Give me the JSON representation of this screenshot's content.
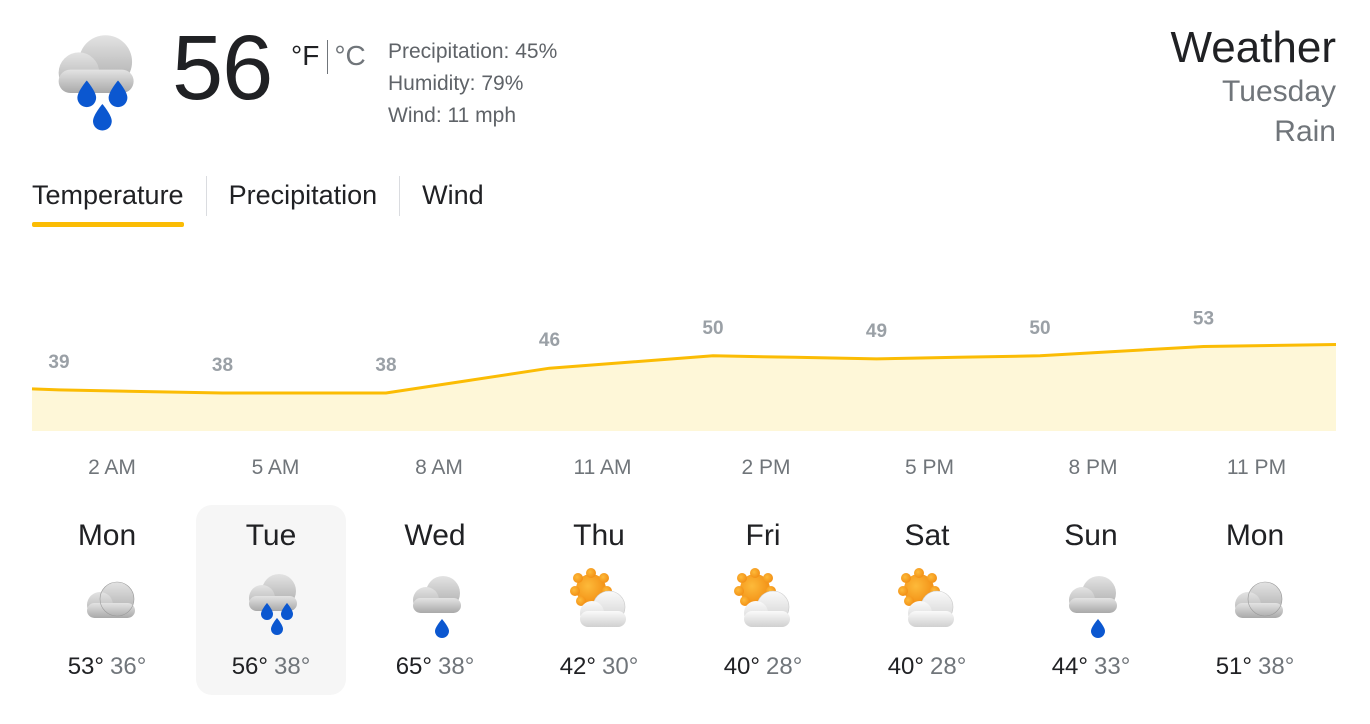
{
  "current": {
    "icon": "rain-icon",
    "temperature": "56",
    "unit_f": "°F",
    "unit_c": "°C",
    "precipitation": "Precipitation: 45%",
    "humidity": "Humidity: 79%",
    "wind": "Wind: 11 mph"
  },
  "header": {
    "title": "Weather",
    "day": "Tuesday",
    "condition": "Rain"
  },
  "tabs": [
    {
      "label": "Temperature",
      "active": true
    },
    {
      "label": "Precipitation",
      "active": false
    },
    {
      "label": "Wind",
      "active": false
    }
  ],
  "chart_data": {
    "type": "area",
    "x": [
      "2 AM",
      "5 AM",
      "8 AM",
      "11 AM",
      "2 PM",
      "5 PM",
      "8 PM",
      "11 PM"
    ],
    "y": [
      39,
      38,
      38,
      46,
      50,
      49,
      50,
      53
    ],
    "data_labels": [
      "39",
      "38",
      "38",
      "46",
      "50",
      "49",
      "50",
      "53"
    ],
    "line_color": "#fbbc04",
    "fill_color": "#fef7d8"
  },
  "days": [
    {
      "name": "Mon",
      "icon": "cloudy-icon",
      "high": "53°",
      "low": "36°",
      "selected": false
    },
    {
      "name": "Tue",
      "icon": "rain-icon",
      "high": "56°",
      "low": "38°",
      "selected": true
    },
    {
      "name": "Wed",
      "icon": "showers-icon",
      "high": "65°",
      "low": "38°",
      "selected": false
    },
    {
      "name": "Thu",
      "icon": "partly-cloudy-icon",
      "high": "42°",
      "low": "30°",
      "selected": false
    },
    {
      "name": "Fri",
      "icon": "partly-cloudy-icon",
      "high": "40°",
      "low": "28°",
      "selected": false
    },
    {
      "name": "Sat",
      "icon": "partly-cloudy-icon",
      "high": "40°",
      "low": "28°",
      "selected": false
    },
    {
      "name": "Sun",
      "icon": "showers-icon",
      "high": "44°",
      "low": "33°",
      "selected": false
    },
    {
      "name": "Mon",
      "icon": "cloudy-icon",
      "high": "51°",
      "low": "38°",
      "selected": false
    }
  ]
}
